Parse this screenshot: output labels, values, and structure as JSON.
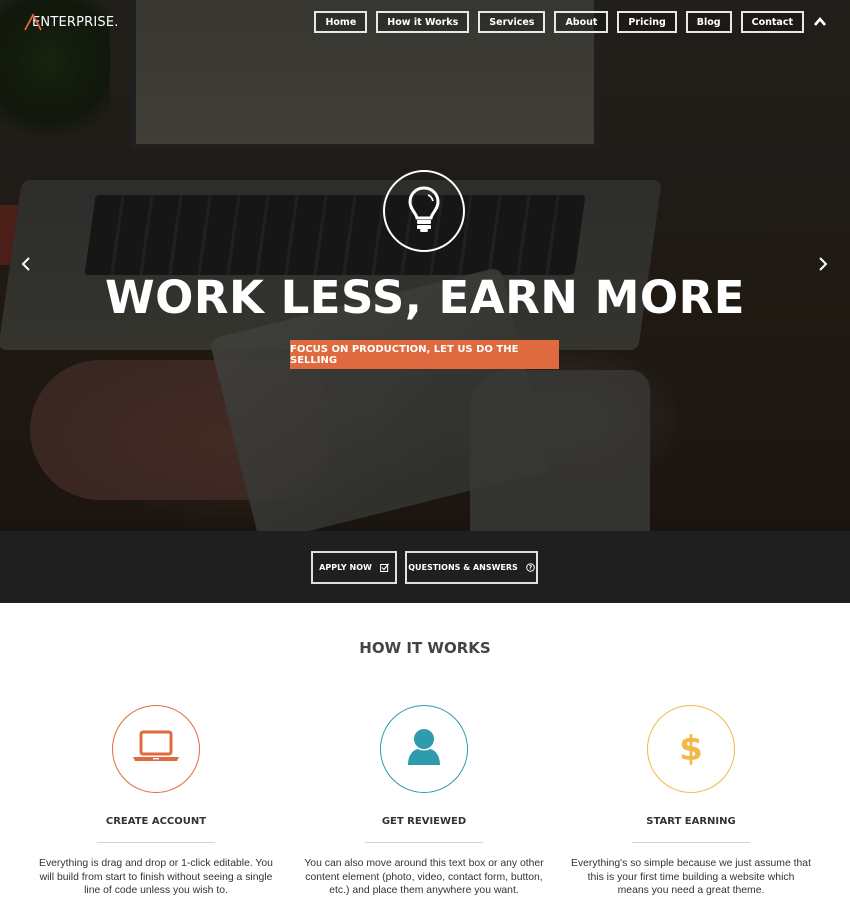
{
  "brand": {
    "name": "ENTERPRISE.",
    "accent": "#e06a3f"
  },
  "nav": {
    "items": [
      {
        "label": "Home"
      },
      {
        "label": "How it Works"
      },
      {
        "label": "Services"
      },
      {
        "label": "About"
      },
      {
        "label": "Pricing"
      },
      {
        "label": "Blog"
      },
      {
        "label": "Contact"
      }
    ],
    "toggle_icon": "chevron-up-icon"
  },
  "hero": {
    "icon": "lightbulb-icon",
    "title": "WORK LESS, EARN MORE",
    "cta_label": "FOCUS ON PRODUCTION, LET US DO THE SELLING",
    "cta_color": "#e06a3f",
    "prev_icon": "chevron-left-icon",
    "next_icon": "chevron-right-icon"
  },
  "actions": {
    "apply_label": "APPLY NOW",
    "apply_icon": "check-square-icon",
    "qa_label": "QUESTIONS & ANSWERS",
    "qa_icon": "question-circle-icon"
  },
  "how_it_works": {
    "title": "HOW IT WORKS",
    "features": [
      {
        "icon": "laptop-icon",
        "color": "#e06a3f",
        "title": "CREATE ACCOUNT",
        "text": "Everything is drag and drop or 1-click editable. You will build from start to finish without seeing a single line of code unless you wish to."
      },
      {
        "icon": "user-icon",
        "color": "#2e9cac",
        "title": "GET REVIEWED",
        "text": "You can also move around this text box or any other content element (photo, video, contact form, button, etc.) and place them anywhere you want."
      },
      {
        "icon": "dollar-icon",
        "color": "#f3b848",
        "title": "START EARNING",
        "text": "Everything's so simple because we just assume that this is your first time building a website which means you need a great theme."
      }
    ]
  }
}
